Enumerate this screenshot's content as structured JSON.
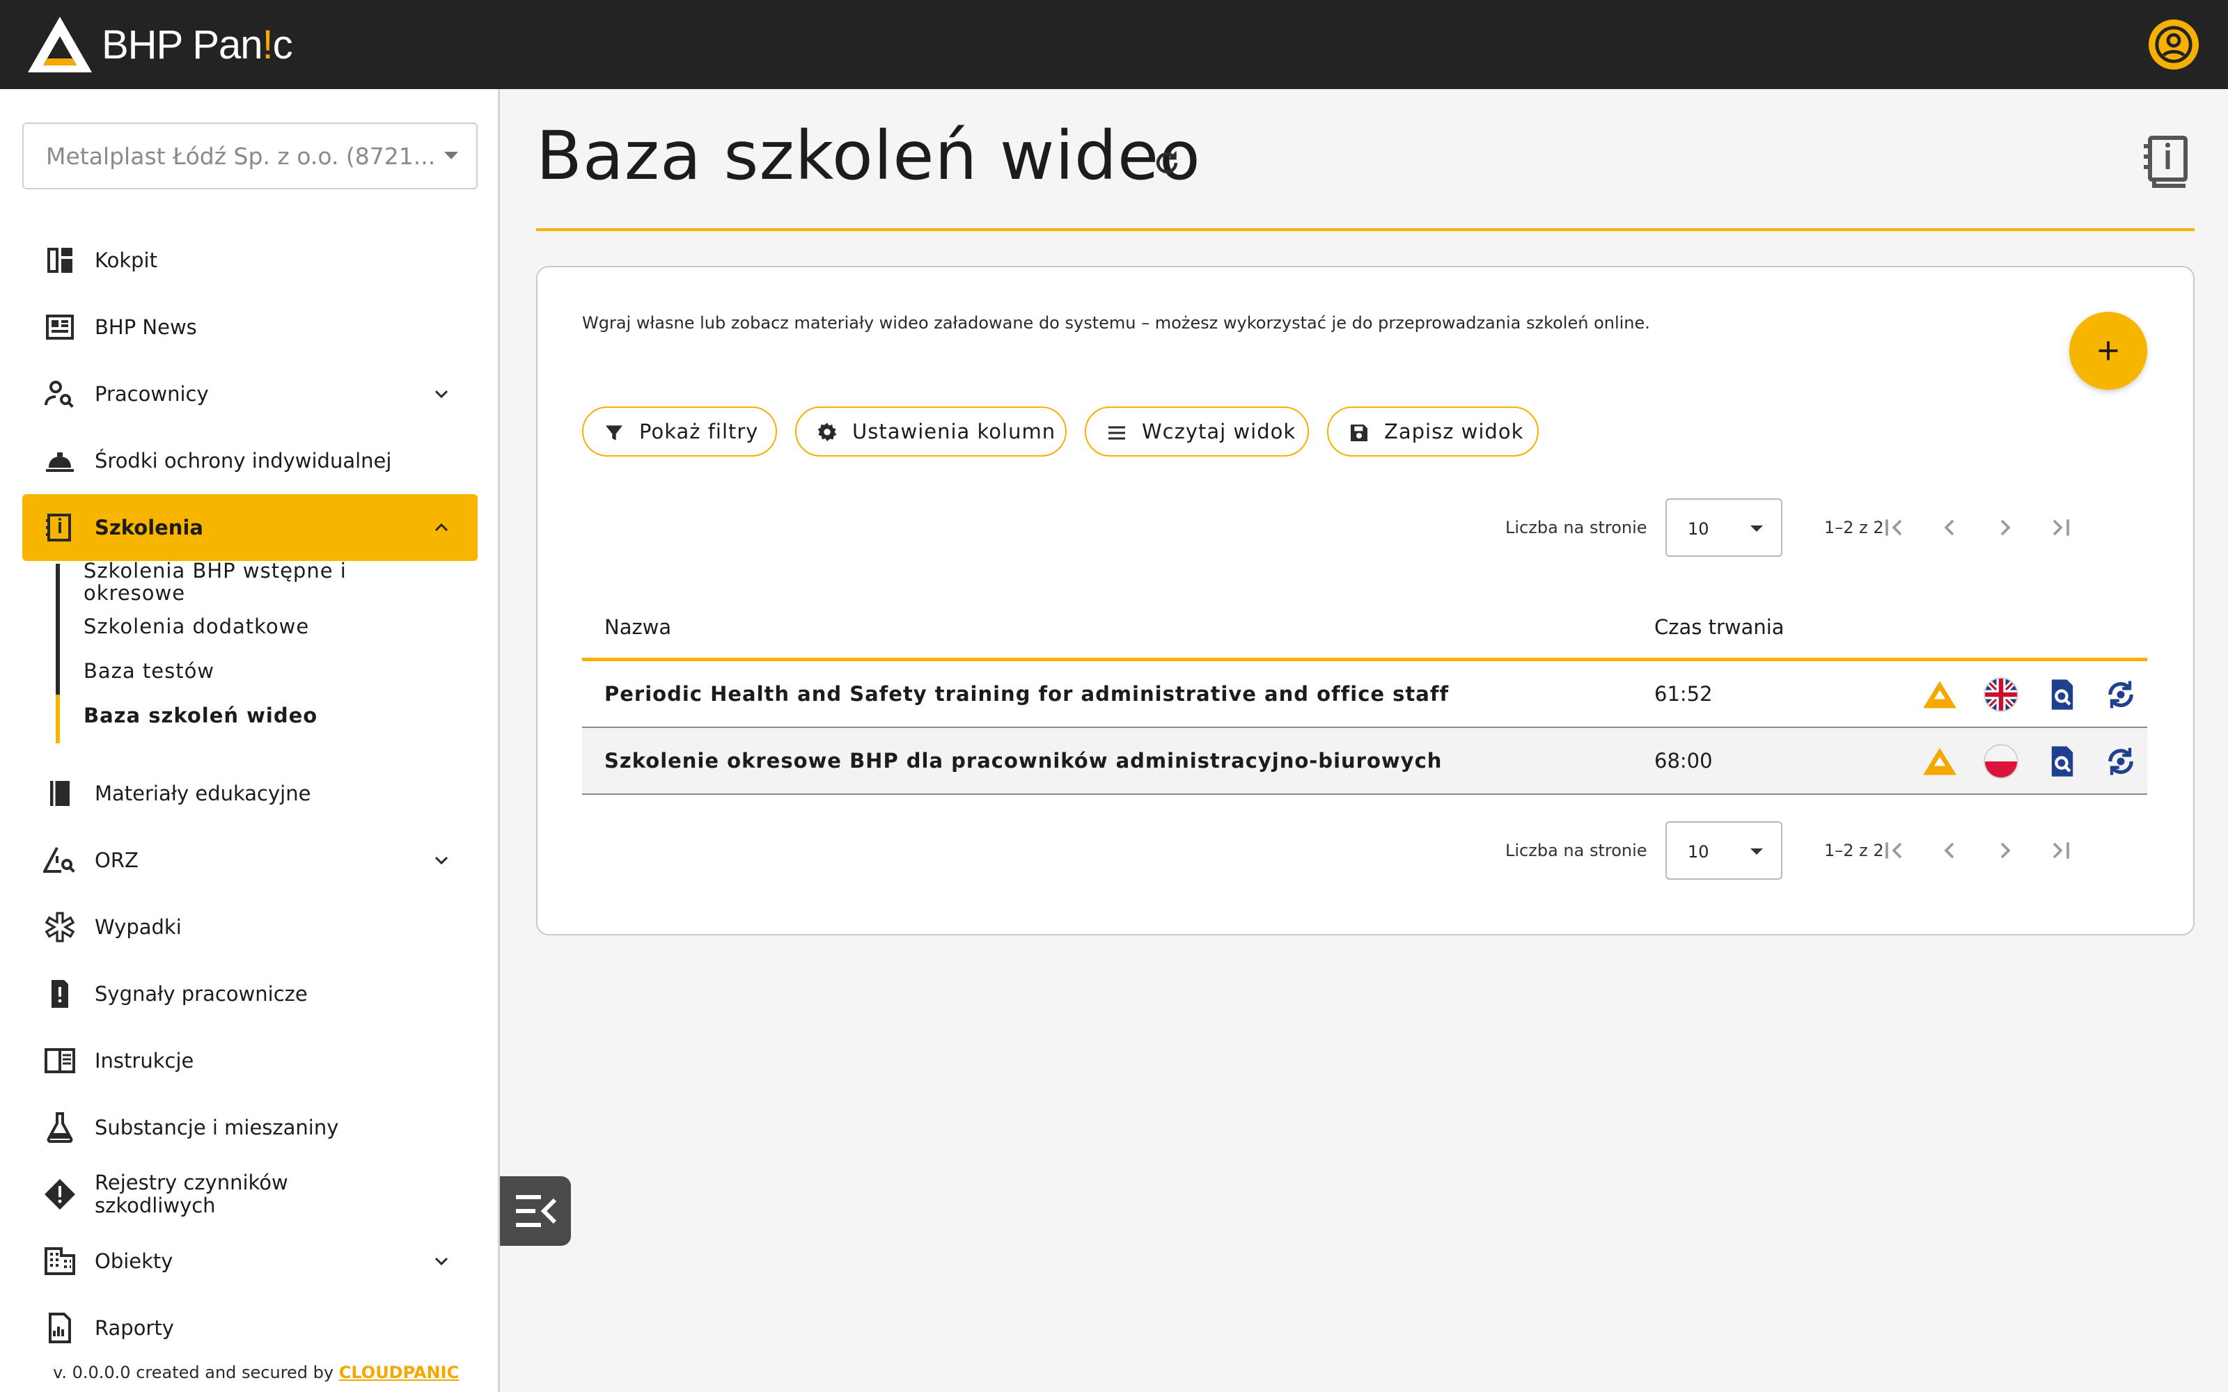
{
  "app": {
    "name_prefix": "BHP Pan",
    "name_accent": "!",
    "name_suffix": "c",
    "brand_color": "#f5b000"
  },
  "sidebar": {
    "company_select": "Metalplast Łódź Sp. z o.o. (8721...",
    "items": [
      {
        "label": "Kokpit",
        "icon": "dashboard-icon"
      },
      {
        "label": "BHP News",
        "icon": "newspaper-icon"
      },
      {
        "label": "Pracownicy",
        "icon": "person-search-icon",
        "expandable": true
      },
      {
        "label": "Środki ochrony indywidualnej",
        "icon": "hard-hat-icon"
      },
      {
        "label": "Szkolenia",
        "icon": "book-info-icon",
        "expanded": true,
        "active": true
      },
      {
        "label": "Materiały edukacyjne",
        "icon": "book-icon"
      },
      {
        "label": "ORZ",
        "icon": "warning-search-icon",
        "expandable": true
      },
      {
        "label": "Wypadki",
        "icon": "medical-star-icon"
      },
      {
        "label": "Sygnały pracownicze",
        "icon": "report-icon"
      },
      {
        "label": "Instrukcje",
        "icon": "menu-book-icon"
      },
      {
        "label": "Substancje i mieszaniny",
        "icon": "flask-icon"
      },
      {
        "label": "Rejestry czynników szkodliwych",
        "icon": "hazard-diamond-icon"
      },
      {
        "label": "Obiekty",
        "icon": "building-icon",
        "expandable": true
      },
      {
        "label": "Raporty",
        "icon": "report-chart-icon"
      }
    ],
    "sub_items": [
      {
        "label": "Szkolenia BHP wstępne i okresowe"
      },
      {
        "label": "Szkolenia dodatkowe"
      },
      {
        "label": "Baza testów"
      },
      {
        "label": "Baza szkoleń wideo",
        "active": true
      }
    ],
    "footer": {
      "version_text": "v. 0.0.0.0 created and secured by ",
      "brand": "CLOUDPANIC"
    }
  },
  "main": {
    "title": "Baza szkoleń wideo",
    "description": "Wgraj własne lub zobacz materiały wideo załadowane do systemu – możesz wykorzystać je do przeprowadzania szkoleń online.",
    "toolbar": {
      "filters": "Pokaż filtry",
      "columns": "Ustawienia kolumn",
      "load_view": "Wczytaj widok",
      "save_view": "Zapisz widok"
    },
    "pagination": {
      "per_page_label": "Liczba na stronie",
      "per_page": "10",
      "range": "1–2 z 2"
    },
    "table": {
      "columns": [
        "Nazwa",
        "Czas trwania"
      ],
      "rows": [
        {
          "name": "Periodic Health and Safety training for administrative and office staff",
          "duration": "61:52",
          "language": "english-flag-icon"
        },
        {
          "name": "Szkolenie okresowe BHP dla pracowników administracyjno-biurowych",
          "duration": "68:00",
          "language": "polish-flag-icon"
        }
      ]
    }
  }
}
